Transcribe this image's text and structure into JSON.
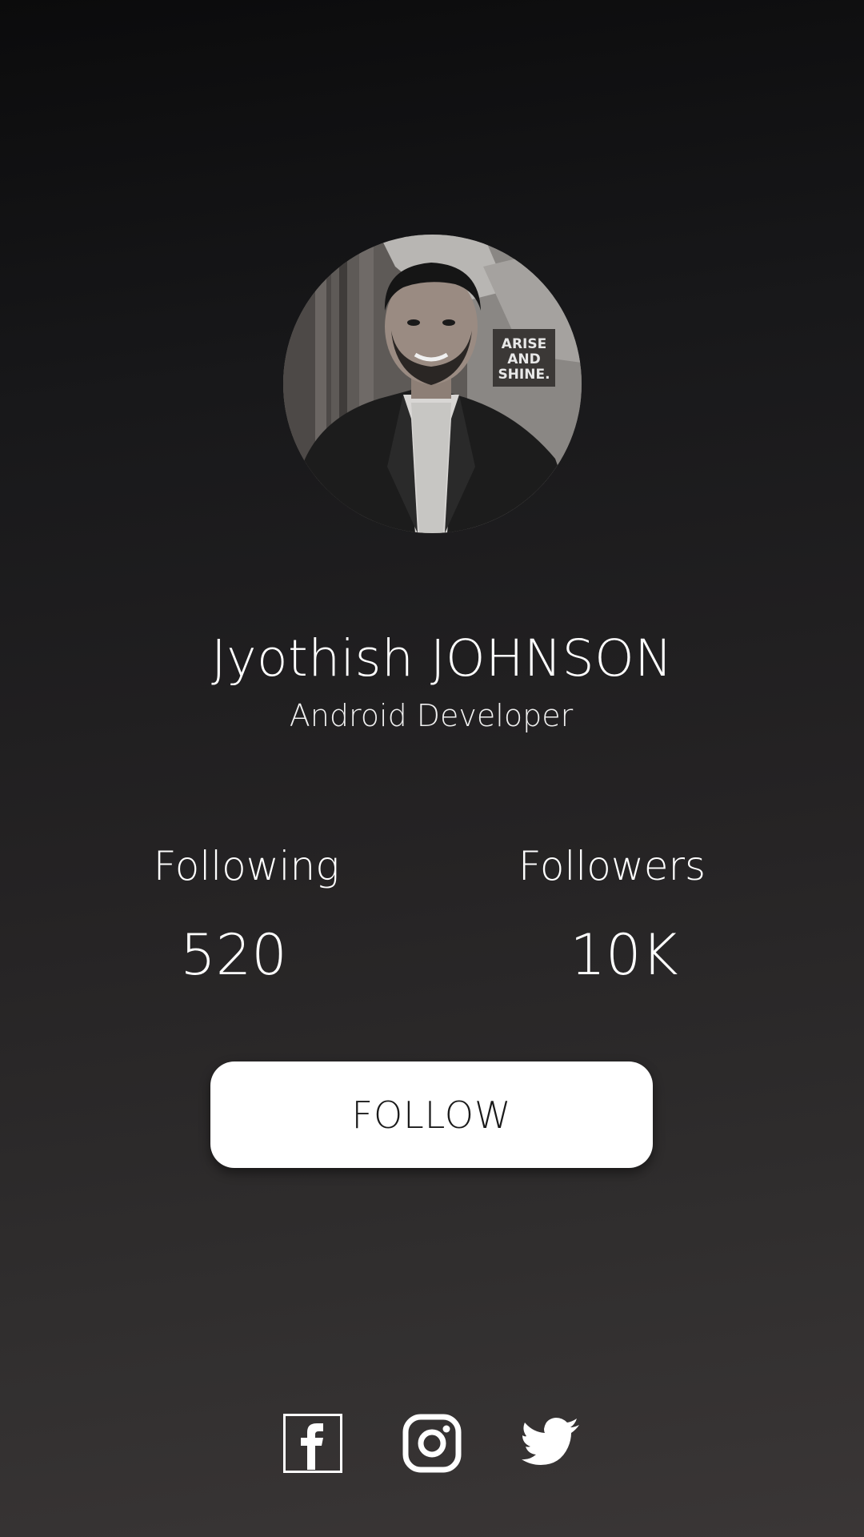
{
  "profile": {
    "name": "Jyothish JOHNSON",
    "title": "Android Developer",
    "avatar_icon": "profile-photo"
  },
  "stats": {
    "following_label": "Following",
    "following_value": "520",
    "followers_label": "Followers",
    "followers_value": "10K"
  },
  "actions": {
    "follow_label": "FOLLOW"
  },
  "social": [
    {
      "name": "facebook-icon"
    },
    {
      "name": "instagram-icon"
    },
    {
      "name": "twitter-icon"
    }
  ],
  "colors": {
    "background_top": "#0b0b0c",
    "background_bottom": "#3a3636",
    "text": "#ffffff",
    "button_bg": "#ffffff",
    "button_text": "#1a1a1a"
  }
}
